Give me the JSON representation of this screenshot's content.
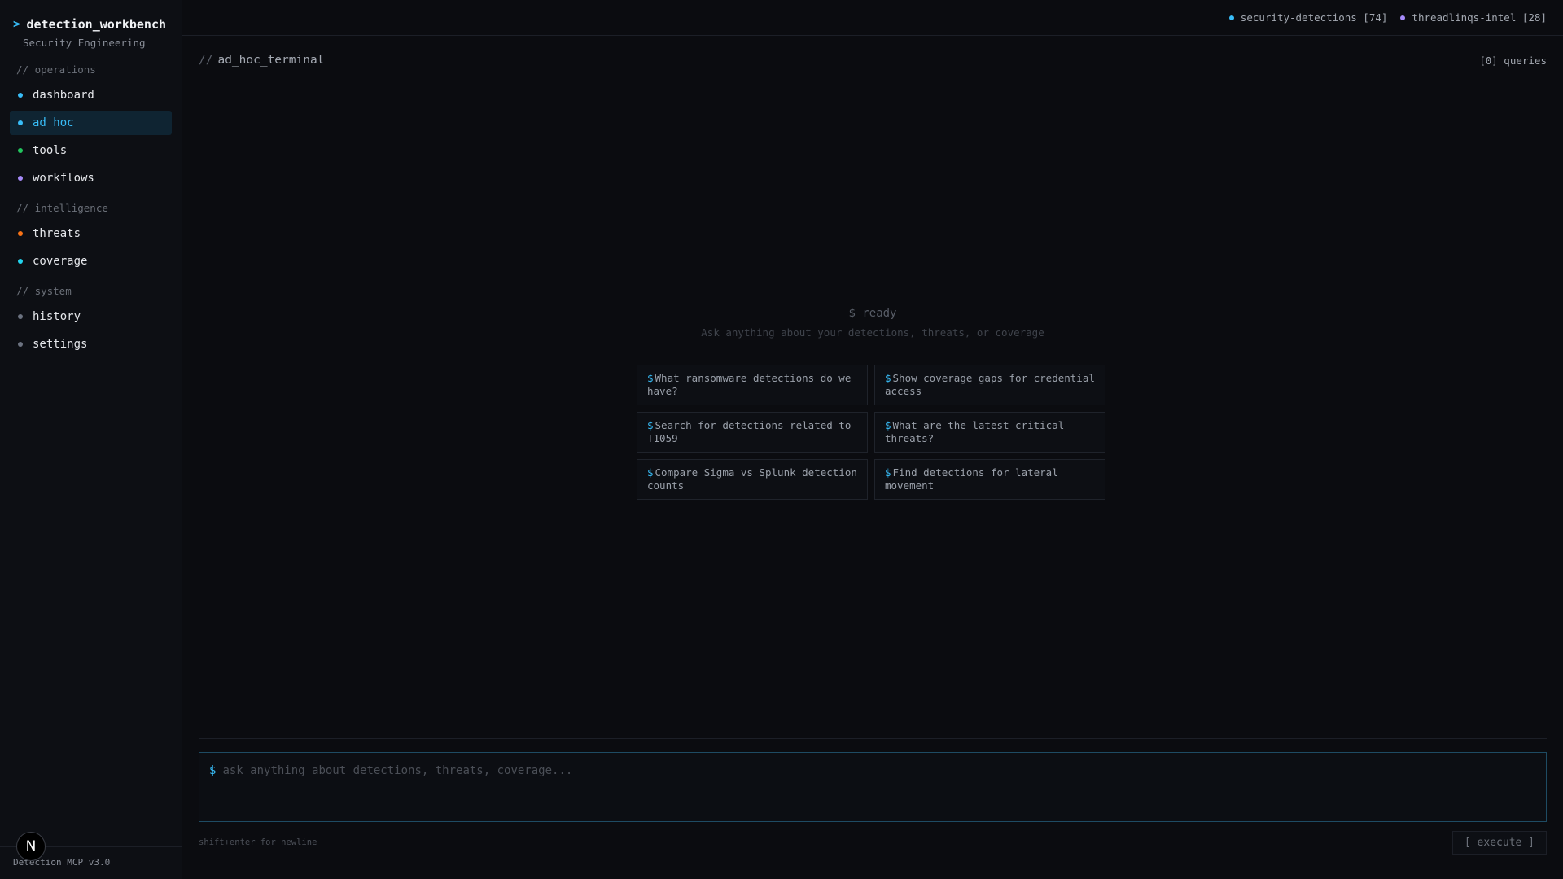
{
  "brand": {
    "prompt": ">",
    "title": "detection_workbench",
    "subtitle": "Security Engineering"
  },
  "sidebar": {
    "sections": [
      {
        "label": "// operations",
        "items": [
          {
            "label": "dashboard",
            "color": "#38bdf8",
            "active": false
          },
          {
            "label": "ad_hoc",
            "color": "#38bdf8",
            "active": true
          },
          {
            "label": "tools",
            "color": "#22c55e",
            "active": false
          },
          {
            "label": "workflows",
            "color": "#a78bfa",
            "active": false
          }
        ]
      },
      {
        "label": "// intelligence",
        "items": [
          {
            "label": "threats",
            "color": "#f97316",
            "active": false
          },
          {
            "label": "coverage",
            "color": "#22d3ee",
            "active": false
          }
        ]
      },
      {
        "label": "// system",
        "items": [
          {
            "label": "history",
            "color": "#6b7280",
            "active": false
          },
          {
            "label": "settings",
            "color": "#6b7280",
            "active": false
          }
        ]
      }
    ],
    "footer": {
      "badge": "N",
      "version": "Detection MCP v3.0"
    }
  },
  "topbar": {
    "sources": [
      {
        "label": "security-detections [74]",
        "color": "#38bdf8"
      },
      {
        "label": "threadlinqs-intel [28]",
        "color": "#a78bfa"
      }
    ]
  },
  "terminal": {
    "slashes": "//",
    "title": "ad_hoc_terminal",
    "query_count": "[0] queries"
  },
  "empty_state": {
    "ready": "$ ready",
    "hint": "Ask anything about your detections, threats, or coverage"
  },
  "suggestions": [
    "What ransomware detections do we have?",
    "Show coverage gaps for credential access",
    "Search for detections related to T1059",
    "What are the latest critical threats?",
    "Compare Sigma vs Splunk detection counts",
    "Find detections for lateral movement"
  ],
  "input": {
    "prompt": "$",
    "placeholder": "ask anything about detections, threats, coverage...",
    "newline_hint": "shift+enter for newline",
    "execute_label": "[ execute ]"
  }
}
